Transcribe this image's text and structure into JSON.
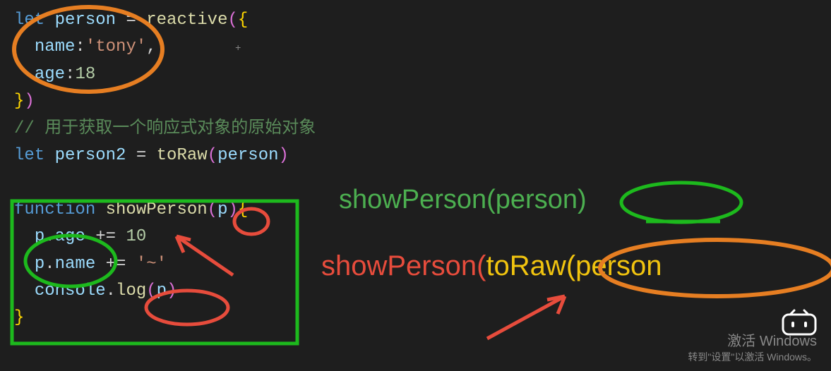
{
  "code": {
    "l1_let": "let",
    "l1_person": " person ",
    "l1_eq": "= ",
    "l1_reactive": "reactive",
    "l1_p1": "(",
    "l1_b1": "{",
    "l2_indent": "  ",
    "l2_name": "name",
    "l2_colon": ":",
    "l2_tony": "'tony'",
    "l2_comma": ",",
    "l3_indent": "  ",
    "l3_age": "age",
    "l3_colon": ":",
    "l3_18": "18",
    "l4_b2": "}",
    "l4_p2": ")",
    "l5_comment": "// 用于获取一个响应式对象的原始对象",
    "l6_let": "let",
    "l6_person2": " person2 ",
    "l6_eq": "= ",
    "l6_toRaw": "toRaw",
    "l6_p1": "(",
    "l6_arg": "person",
    "l6_p2": ")",
    "l8_fn": "function",
    "l8_name": " showPerson",
    "l8_p1": "(",
    "l8_p": "p",
    "l8_p2": ")",
    "l8_b1": "{",
    "l9_indent": "  ",
    "l9_p": "p",
    "l9_dot": ".",
    "l9_age": "age ",
    "l9_op": "+= ",
    "l9_10": "10",
    "l10_indent": "  ",
    "l10_p": "p",
    "l10_dot": ".",
    "l10_name": "name ",
    "l10_op": "+= ",
    "l10_str": "'~'",
    "l11_indent": "  ",
    "l11_console": "console",
    "l11_dot": ".",
    "l11_log": "log",
    "l11_p1": "(",
    "l11_arg": "p",
    "l11_p2": ")",
    "l12_b2": "}"
  },
  "annotations": {
    "call1_fn": "showPerson(",
    "call1_arg": "person",
    "call1_close": ")",
    "call2_fn": "showPerson(",
    "call2_toRaw": "toRaw(",
    "call2_arg": "person",
    "plus": "+"
  },
  "watermark": {
    "l1": "激活 Windows",
    "l2": "转到\"设置\"以激活 Windows。"
  }
}
